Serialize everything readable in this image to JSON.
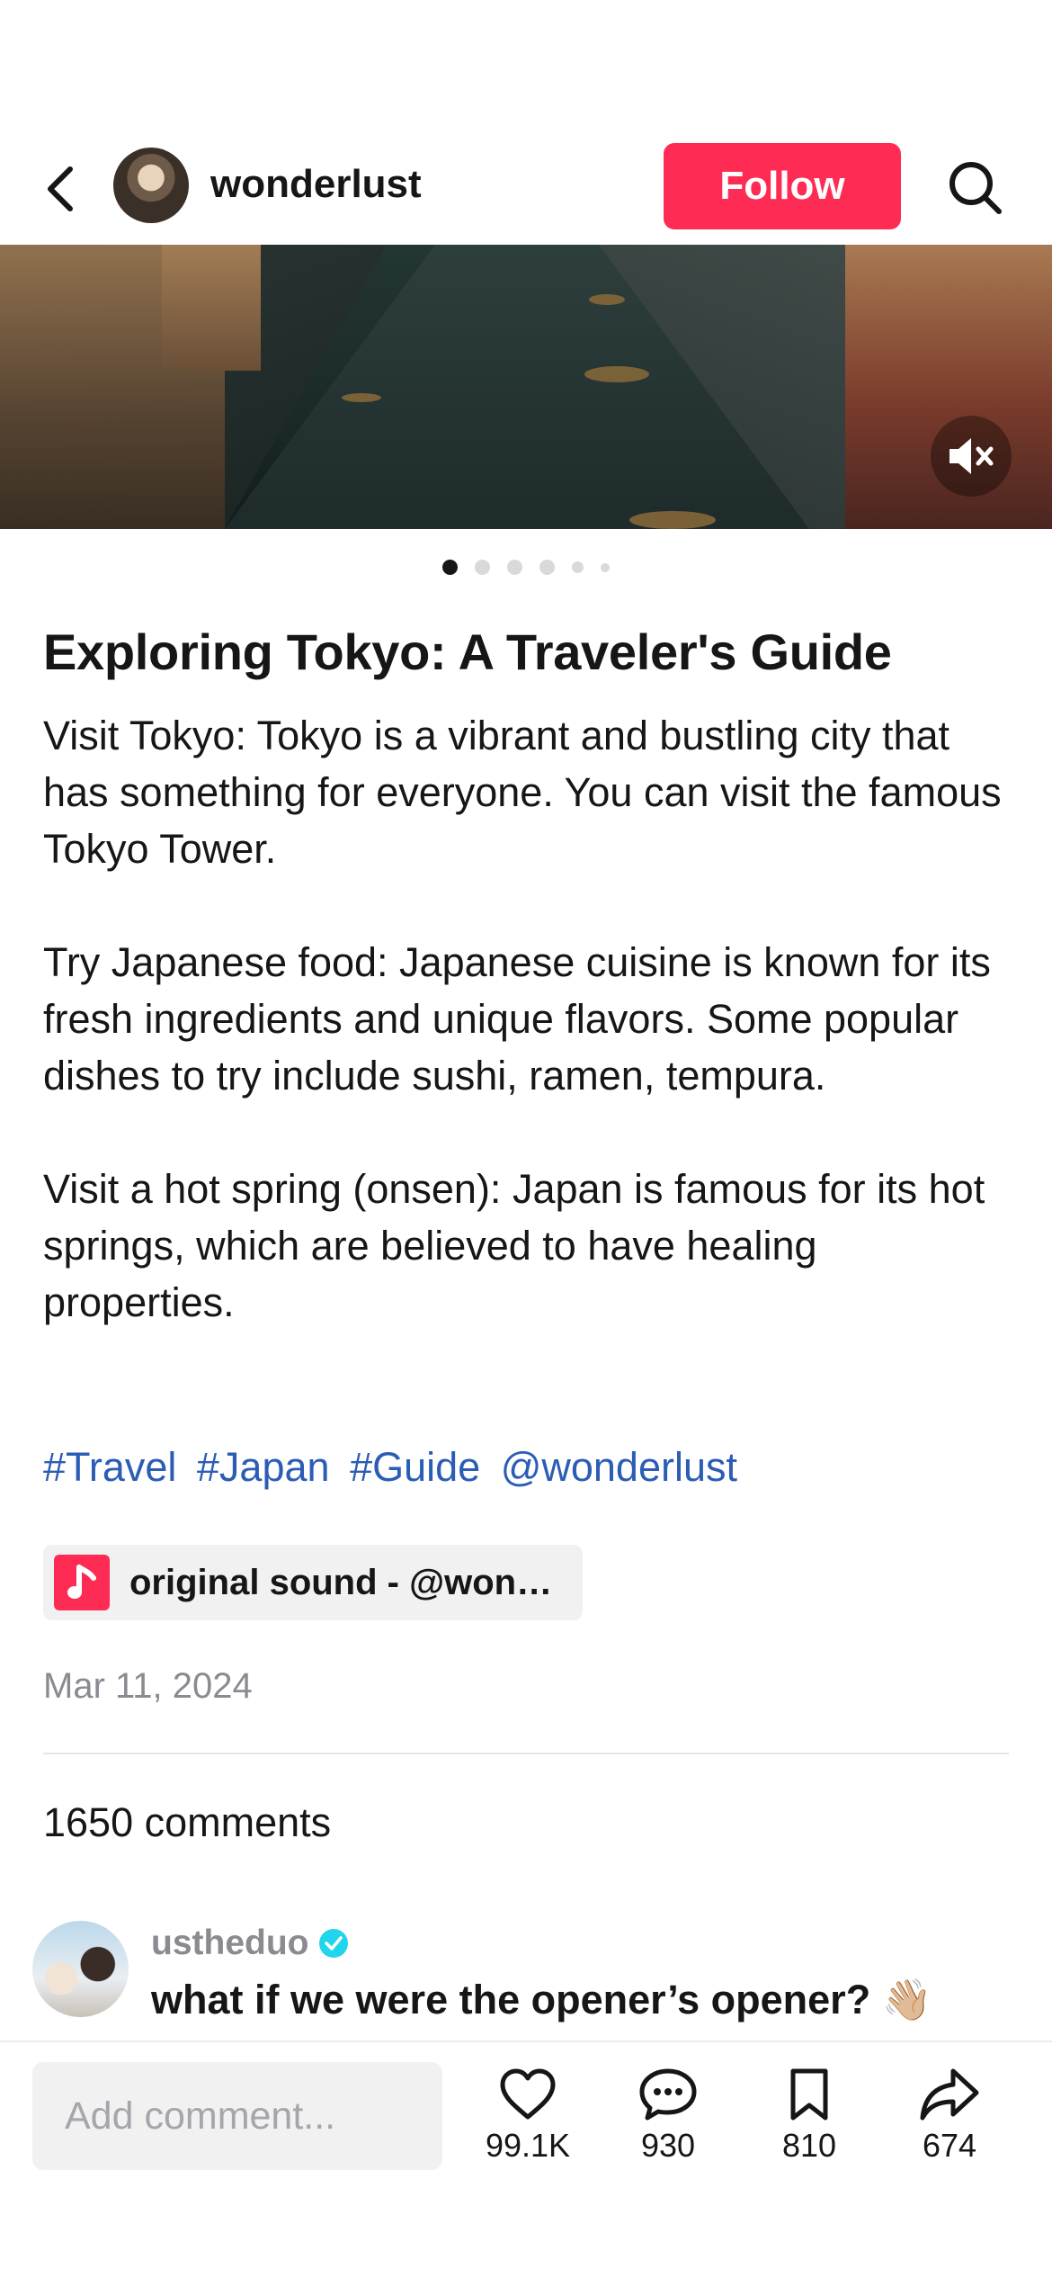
{
  "header": {
    "username": "wonderlust",
    "follow_label": "Follow"
  },
  "carousel": {
    "total_slides": 6,
    "active_index": 0
  },
  "post": {
    "title": "Exploring Tokyo: A Traveler's Guide",
    "paragraphs": [
      "Visit Tokyo: Tokyo is a vibrant and bustling city that has something for everyone. You can visit the famous Tokyo Tower.",
      "Try Japanese food: Japanese cuisine is known for its fresh ingredients and unique flavors. Some popular dishes to try include sushi, ramen, tempura.",
      "Visit a hot spring (onsen): Japan is famous for its hot springs, which are believed to have healing properties."
    ],
    "tags": [
      "#Travel",
      "#Japan",
      "#Guide",
      "@wonderlust"
    ],
    "sound_label": "original sound - @wonderlust",
    "date": "Mar 11, 2024"
  },
  "comments": {
    "count_label": "1650 comments",
    "items": [
      {
        "username": "ustheduo",
        "verified": true,
        "text": "what if we were the opener’s opener? 👋🏼"
      }
    ]
  },
  "bottom_bar": {
    "input_placeholder": "Add comment...",
    "likes": "99.1K",
    "comments": "930",
    "saves": "810",
    "shares": "674"
  },
  "colors": {
    "accent": "#fe2c55",
    "link": "#2b5db5",
    "verified": "#20d5ec"
  }
}
